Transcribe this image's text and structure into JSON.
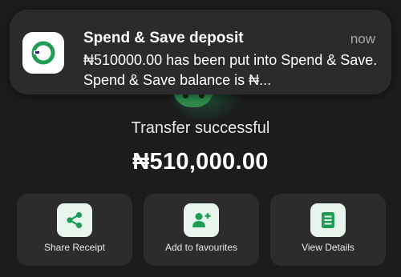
{
  "notification": {
    "title": "Spend & Save deposit",
    "time": "now",
    "message": "₦510000.00 has been put into Spend & Save. Spend & Save balance is ₦..."
  },
  "transfer": {
    "status": "Transfer successful",
    "amount": "₦510,000.00"
  },
  "actions": [
    {
      "label": "Share Receipt",
      "icon": "share-icon"
    },
    {
      "label": "Add to favourites",
      "icon": "add-user-icon"
    },
    {
      "label": "View Details",
      "icon": "document-list-icon"
    }
  ],
  "colors": {
    "accent": "#1f9d55",
    "icon_background": "#e8f5ec",
    "card_background": "#2c2c2e",
    "page_background": "#1c1c1e"
  }
}
